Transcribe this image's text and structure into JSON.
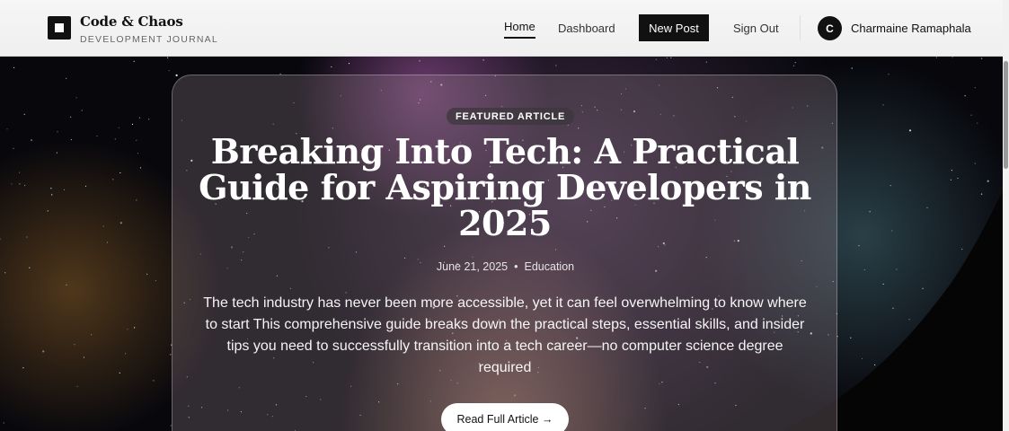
{
  "brand": {
    "title": "Code & Chaos",
    "subtitle": "DEVELOPMENT JOURNAL"
  },
  "nav": {
    "home": "Home",
    "dashboard": "Dashboard",
    "new_post": "New Post",
    "sign_out": "Sign Out"
  },
  "user": {
    "initial": "C",
    "name": "Charmaine Ramaphala"
  },
  "hero": {
    "badge": "FEATURED ARTICLE",
    "title": "Breaking Into Tech: A Practical Guide for Aspiring Developers in 2025",
    "date": "June 21, 2025",
    "separator": "•",
    "category": "Education",
    "excerpt": "The tech industry has never been more accessible, yet it can feel overwhelming to know where to start This comprehensive guide breaks down the practical steps, essential skills, and insider tips you need to successfully transition into a tech career—no computer science degree required",
    "cta": "Read Full Article →"
  },
  "icons": {
    "logo": "square-logo-icon"
  },
  "colors": {
    "header_bg": "#f3f3f3",
    "primary": "#111111",
    "card_tint": "#96828c"
  }
}
